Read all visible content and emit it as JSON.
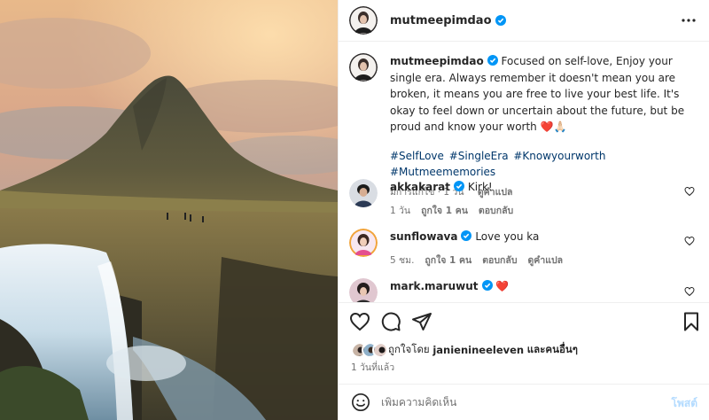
{
  "header": {
    "username": "mutmeepimdao",
    "more_icon": "more-horizontal-icon"
  },
  "caption": {
    "username": "mutmeepimdao",
    "text": "Focused on self-love, Enjoy your single era. Always remember it doesn't mean you are broken, it means you are free to live your best life. It's okay to feel down or uncertain about the future, but be proud and know your worth",
    "emoji": "❤️🙏🏻",
    "hashtags": "#SelfLove #SingleEra #Knowyourworth #Mutmeememories",
    "edited": "มีการแก้ไข · 1 วัน",
    "see_translation": "ดูคำแปล"
  },
  "comments": [
    {
      "username": "akkakarat",
      "text": "Kirk!",
      "time": "1 วัน",
      "likes": "ถูกใจ 1 คน",
      "reply": "ตอบกลับ",
      "translate": ""
    },
    {
      "username": "sunflowava",
      "text": "Love you ka",
      "time": "5 ชม.",
      "likes": "ถูกใจ 1 คน",
      "reply": "ตอบกลับ",
      "translate": "ดูคำแปล"
    },
    {
      "username": "mark.maruwut",
      "text": "❤️",
      "time": "",
      "likes": "",
      "reply": "",
      "translate": ""
    }
  ],
  "actions": {
    "like_icon": "heart-icon",
    "comment_icon": "comment-icon",
    "share_icon": "send-icon",
    "save_icon": "bookmark-icon"
  },
  "likes": {
    "prefix": "ถูกใจโดย",
    "user": "janienineeleven",
    "suffix": "และคนอื่นๆ"
  },
  "timestamp": "1 วันที่แล้ว",
  "add_comment": {
    "placeholder": "เพิ่มความคิดเห็น",
    "post_label": "โพสต์",
    "emoji_icon": "smile-icon"
  },
  "colors": {
    "verified": "#0095f6",
    "heart": "#ed4956",
    "hashtag": "#00376b",
    "post_disabled": "#b3dbff"
  }
}
